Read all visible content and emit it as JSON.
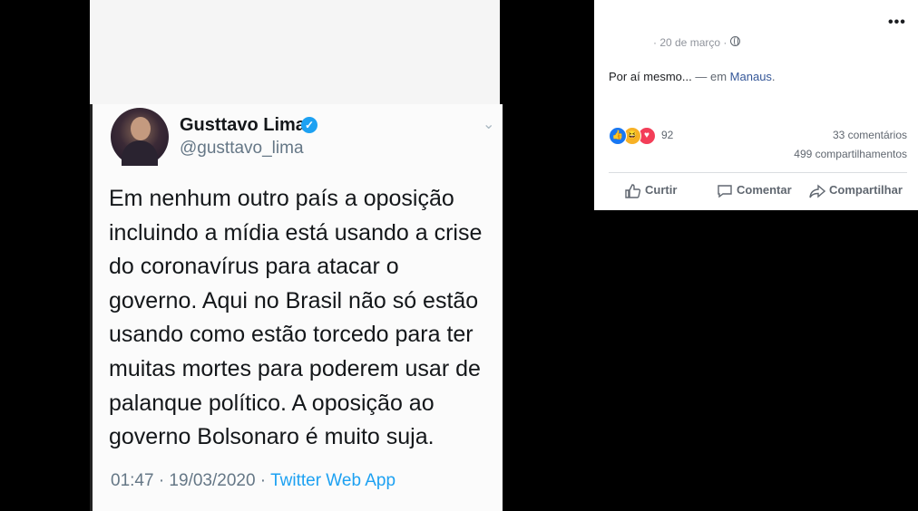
{
  "tweet": {
    "author_name": "Gusttavo Lima",
    "author_handle": "@gusttavo_lima",
    "text": "Em nenhum outro país a oposição incluindo a mídia está usando a crise do coronavírus para atacar o governo. Aqui no Brasil não só estão usando como estão torcedo para ter muitas mortes para poderem usar de palanque político. A oposição ao governo Bolsonaro é muito suja.",
    "timestamp": "01:47 · 19/03/2020 ·",
    "source": "Twitter Web App"
  },
  "post": {
    "date": "· 20 de março ·",
    "text_main": "Por aí mesmo...",
    "text_location_prefix": "— em",
    "location": "Manaus",
    "location_suffix": ".",
    "reaction_count": "92",
    "comments": "33 comentários",
    "shares": "499 compartilhamentos"
  },
  "actions": {
    "like": "Curtir",
    "comment": "Comentar",
    "share": "Compartilhar"
  },
  "icons": {
    "verified": "verified-badge-icon",
    "chevron": "chevron-down-icon",
    "globe": "globe-icon",
    "more": "more-options-icon",
    "like": "thumbs-up-icon",
    "comment": "comment-bubble-icon",
    "share": "share-arrow-icon"
  },
  "colors": {
    "twitter_blue": "#1da1f2",
    "facebook_link": "#365899",
    "like_blue": "#1877f2",
    "love_red": "#f33e58",
    "haha_yellow": "#f7b125"
  }
}
